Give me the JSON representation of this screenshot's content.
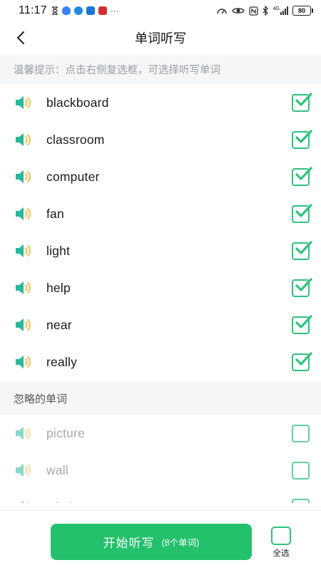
{
  "status_bar": {
    "time": "11:17",
    "signal_label": "4G",
    "battery": "80"
  },
  "header": {
    "title": "单词听写"
  },
  "tip": "温馨提示：点击右侧复选框，可选择听写单词",
  "selected_words": [
    {
      "word": "blackboard",
      "checked": true
    },
    {
      "word": "classroom",
      "checked": true
    },
    {
      "word": "computer",
      "checked": true
    },
    {
      "word": "fan",
      "checked": true
    },
    {
      "word": "light",
      "checked": true
    },
    {
      "word": "help",
      "checked": true
    },
    {
      "word": "near",
      "checked": true
    },
    {
      "word": "really",
      "checked": true
    }
  ],
  "ignored_section": {
    "title": "忽略的单词",
    "words": [
      {
        "word": "picture",
        "checked": false
      },
      {
        "word": "wall",
        "checked": false
      },
      {
        "word": "window",
        "checked": false
      }
    ]
  },
  "bottom": {
    "start_label": "开始听写",
    "start_count": "(8个单词)",
    "select_all_label": "全选"
  },
  "colors": {
    "accent": "#23c16b",
    "speaker": "#27b99a",
    "speaker_waves": "#f2c14e"
  },
  "icons": {
    "back": "chevron-left-icon",
    "speaker": "speaker-icon",
    "check": "checkmark-icon"
  }
}
